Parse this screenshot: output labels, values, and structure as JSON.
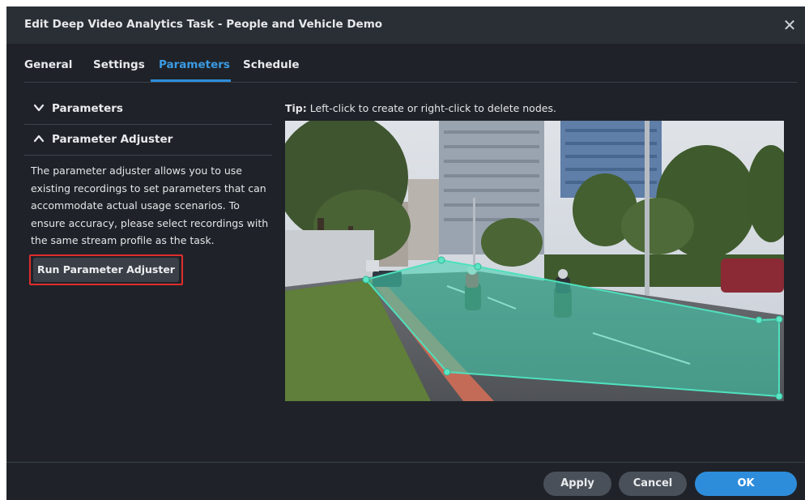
{
  "dialog": {
    "title": "Edit Deep Video Analytics Task - People and Vehicle Demo",
    "close_icon": "close-icon"
  },
  "tabs": [
    {
      "label": "General",
      "active": false
    },
    {
      "label": "Settings",
      "active": false
    },
    {
      "label": "Parameters",
      "active": true
    },
    {
      "label": "Schedule",
      "active": false
    }
  ],
  "sidebar": {
    "parameters_section": {
      "label": "Parameters",
      "icon": "chevron-down-icon"
    },
    "adjuster_section": {
      "label": "Parameter Adjuster",
      "icon": "chevron-up-icon"
    },
    "description": "The parameter adjuster allows you to use existing recordings to set parameters that can accommodate actual usage scenarios. To ensure accuracy, please select recordings with the same stream profile as the task.",
    "run_button_label": "Run Parameter Adjuster"
  },
  "preview": {
    "tip_label": "Tip:",
    "tip_text": " Left-click to create or right-click to delete nodes."
  },
  "footer": {
    "apply_label": "Apply",
    "cancel_label": "Cancel",
    "ok_label": "OK"
  },
  "colors": {
    "accent": "#2e8ddb",
    "highlight_outline": "#e02d2d",
    "detection_zone": "#3fd3b0"
  }
}
